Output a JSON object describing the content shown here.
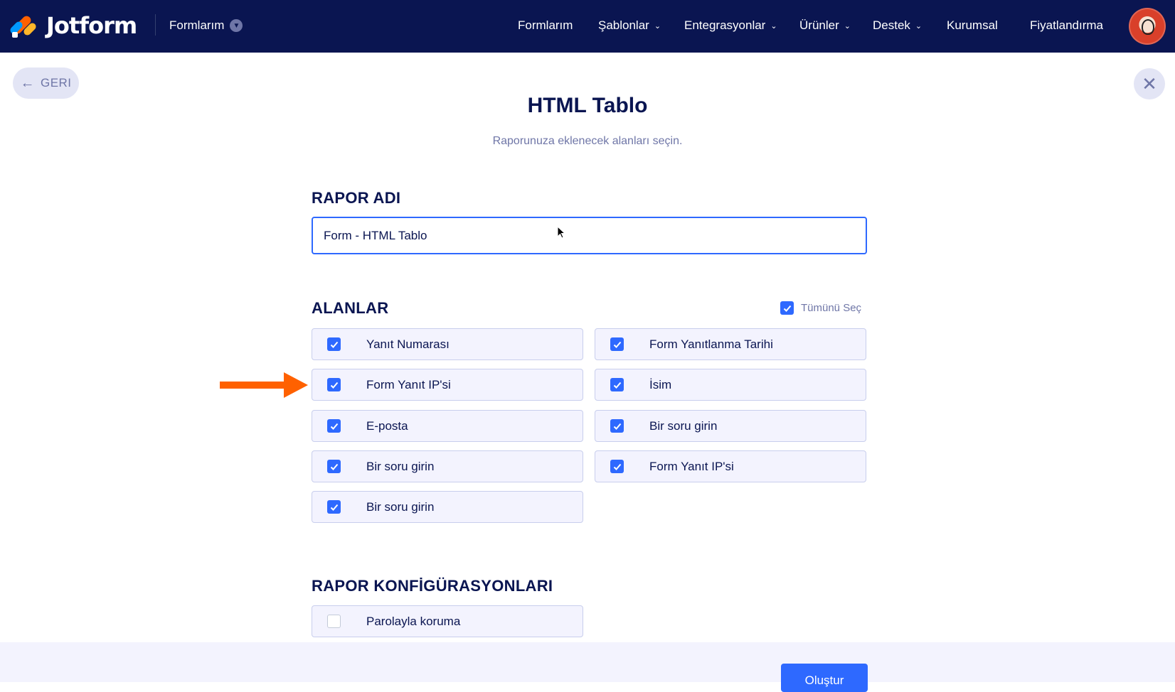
{
  "header": {
    "brand": "Jotform",
    "my_forms": "Formlarım",
    "nav": [
      {
        "label": "Formlarım",
        "has_caret": false
      },
      {
        "label": "Şablonlar",
        "has_caret": true
      },
      {
        "label": "Entegrasyonlar",
        "has_caret": true
      },
      {
        "label": "Ürünler",
        "has_caret": true
      },
      {
        "label": "Destek",
        "has_caret": true
      },
      {
        "label": "Kurumsal",
        "has_caret": false
      },
      {
        "label": "Fiyatlandırma",
        "has_caret": false
      }
    ],
    "colors": {
      "background": "#0a1551",
      "accent": "#ff6100"
    }
  },
  "back_button": {
    "label": "GERI",
    "icon": "arrow-left-icon"
  },
  "close_button": {
    "icon": "close-icon",
    "glyph": "✕"
  },
  "page": {
    "title": "HTML Tablo",
    "subtitle": "Raporunuza eklenecek alanları seçin."
  },
  "report_name": {
    "section_title": "RAPOR ADI",
    "value": "Form - HTML Tablo"
  },
  "fields": {
    "section_title": "ALANLAR",
    "select_all": {
      "label": "Tümünü Seç",
      "checked": true
    },
    "left": [
      {
        "label": "Yanıt Numarası",
        "checked": true
      },
      {
        "label": "Form Yanıt IP'si",
        "checked": true
      },
      {
        "label": "E-posta",
        "checked": true
      },
      {
        "label": "Bir soru girin",
        "checked": true
      },
      {
        "label": "Bir soru girin",
        "checked": true
      }
    ],
    "right": [
      {
        "label": "Form Yanıtlanma Tarihi",
        "checked": true
      },
      {
        "label": "İsim",
        "checked": true
      },
      {
        "label": "Bir soru girin",
        "checked": true
      },
      {
        "label": "Form Yanıt IP'si",
        "checked": true
      }
    ]
  },
  "config": {
    "section_title": "RAPOR KONFİGÜRASYONLARI",
    "options": [
      {
        "label": "Parolayla koruma",
        "checked": false
      }
    ]
  },
  "footer": {
    "create_label": "Oluştur"
  },
  "colors": {
    "primary": "#2e69ff",
    "annotation_arrow": "#ff6100",
    "field_bg": "#f3f3fe"
  }
}
